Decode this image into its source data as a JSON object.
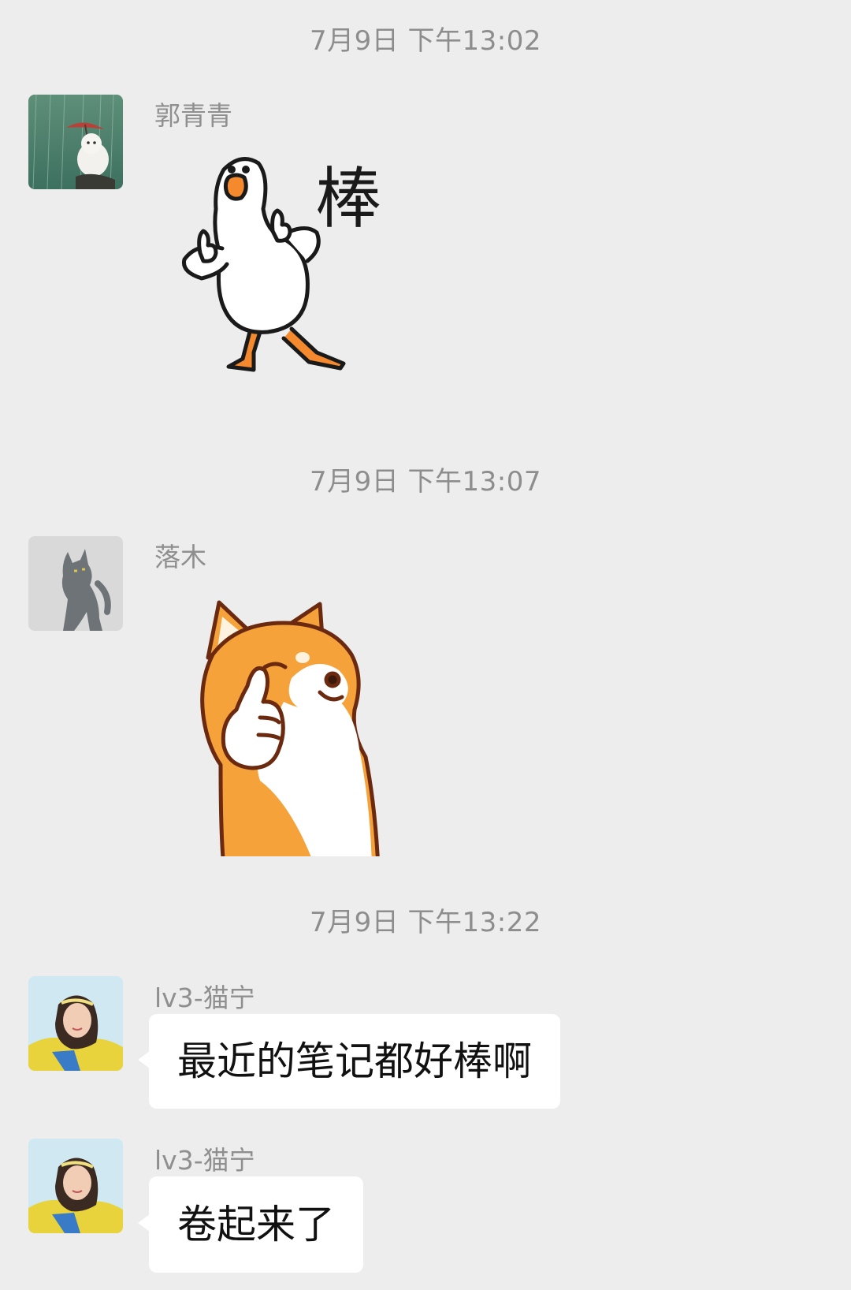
{
  "messages": [
    {
      "timestamp": "7月9日 下午13:02",
      "sender": "郭青青",
      "avatar_icon": "white-cat-with-umbrella-avatar",
      "content_type": "sticker",
      "sticker": {
        "icon": "goose-thumbs-up-sticker",
        "caption": "棒"
      }
    },
    {
      "timestamp": "7月9日 下午13:07",
      "sender": "落木",
      "avatar_icon": "gray-cat-avatar",
      "content_type": "sticker",
      "sticker": {
        "icon": "shiba-thumbs-up-sticker"
      }
    },
    {
      "timestamp": "7月9日 下午13:22",
      "sender": "lv3-猫宁",
      "avatar_icon": "girl-in-yellow-avatar",
      "content_type": "text",
      "text": "最近的笔记都好棒啊"
    },
    {
      "sender": "lv3-猫宁",
      "avatar_icon": "girl-in-yellow-avatar",
      "content_type": "text",
      "text": "卷起来了"
    }
  ],
  "colors": {
    "background": "#ededed",
    "bubble": "#ffffff",
    "meta_text": "#8d8d8d",
    "goose_orange": "#f5892d",
    "shiba_orange": "#f6a23a"
  }
}
